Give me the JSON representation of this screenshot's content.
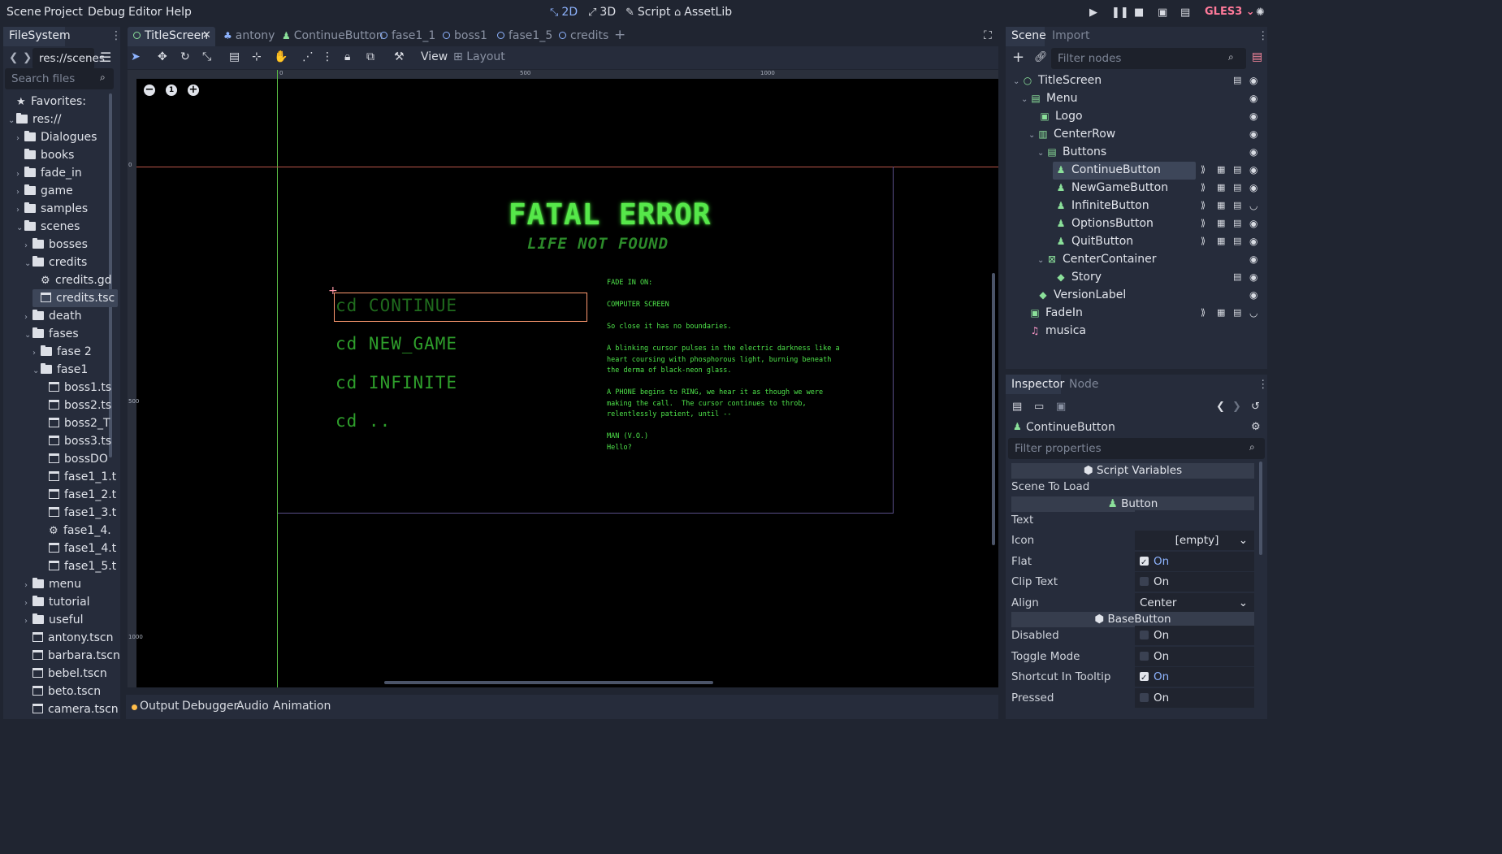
{
  "menu": [
    "Scene",
    "Project",
    "Debug",
    "Editor",
    "Help"
  ],
  "modes": {
    "m2d": "2D",
    "m3d": "3D",
    "script": "Script",
    "assetlib": "AssetLib"
  },
  "renderer": "GLES3",
  "filesystem": {
    "tab": "FileSystem",
    "path": "res://scenes",
    "search_placeholder": "Search files",
    "rows": [
      {
        "label": "Favorites:",
        "kind": "star"
      },
      {
        "label": "res://",
        "kind": "folder"
      },
      {
        "label": "Dialogues",
        "kind": "folder"
      },
      {
        "label": "books",
        "kind": "folder"
      },
      {
        "label": "fade_in",
        "kind": "folder"
      },
      {
        "label": "game",
        "kind": "folder"
      },
      {
        "label": "samples",
        "kind": "folder"
      },
      {
        "label": "scenes",
        "kind": "folder"
      },
      {
        "label": "bosses",
        "kind": "folder"
      },
      {
        "label": "credits",
        "kind": "folder"
      },
      {
        "label": "credits.gd",
        "kind": "gear"
      },
      {
        "label": "credits.tsc",
        "kind": "file"
      },
      {
        "label": "death",
        "kind": "folder"
      },
      {
        "label": "fases",
        "kind": "folder"
      },
      {
        "label": "fase 2",
        "kind": "folder"
      },
      {
        "label": "fase1",
        "kind": "folder"
      },
      {
        "label": "boss1.ts",
        "kind": "file"
      },
      {
        "label": "boss2.ts",
        "kind": "file"
      },
      {
        "label": "boss2_T",
        "kind": "file"
      },
      {
        "label": "boss3.ts",
        "kind": "file"
      },
      {
        "label": "bossDO",
        "kind": "file"
      },
      {
        "label": "fase1_1.t",
        "kind": "file"
      },
      {
        "label": "fase1_2.t",
        "kind": "file"
      },
      {
        "label": "fase1_3.t",
        "kind": "file"
      },
      {
        "label": "fase1_4.",
        "kind": "gear"
      },
      {
        "label": "fase1_4.t",
        "kind": "file"
      },
      {
        "label": "fase1_5.t",
        "kind": "file"
      },
      {
        "label": "menu",
        "kind": "folder"
      },
      {
        "label": "tutorial",
        "kind": "folder"
      },
      {
        "label": "useful",
        "kind": "folder"
      },
      {
        "label": "antony.tscn",
        "kind": "file"
      },
      {
        "label": "barbara.tscn",
        "kind": "file"
      },
      {
        "label": "bebel.tscn",
        "kind": "file"
      },
      {
        "label": "beto.tscn",
        "kind": "file"
      },
      {
        "label": "camera.tscn",
        "kind": "file"
      }
    ]
  },
  "editor_tabs": [
    "TitleScreen",
    "antony",
    "ContinueButton",
    "fase1_1",
    "boss1",
    "fase1_5",
    "credits"
  ],
  "toolbar": {
    "view": "View",
    "layout": "Layout"
  },
  "rulers": {
    "r0": "0",
    "r500": "500",
    "r1000": "1000"
  },
  "game": {
    "title": "FATAL ERROR",
    "subtitle": "LIFE NOT FOUND",
    "buttons": [
      "cd CONTINUE",
      "cd NEW_GAME",
      "cd INFINITE",
      "cd .."
    ],
    "story": "FADE IN ON:\n\nCOMPUTER SCREEN\n\nSo close it has no boundaries.\n\nA blinking cursor pulses in the electric darkness like a\nheart coursing with phosphorous light, burning beneath\nthe derma of black-neon glass.\n\nA PHONE begins to RING, we hear it as though we were\nmaking the call.  The cursor continues to throb,\nrelentlessly patient, until --\n\nMAN (V.O.)\nHello?"
  },
  "bottom_tabs": [
    "Output",
    "Debugger",
    "Audio",
    "Animation"
  ],
  "scene_dock": {
    "tabs": [
      "Scene",
      "Import"
    ],
    "filter_placeholder": "Filter nodes",
    "nodes": [
      "TitleScreen",
      "Menu",
      "Logo",
      "CenterRow",
      "Buttons",
      "ContinueButton",
      "NewGameButton",
      "InfiniteButton",
      "OptionsButton",
      "QuitButton",
      "CenterContainer",
      "Story",
      "VersionLabel",
      "FadeIn",
      "musica"
    ]
  },
  "inspector": {
    "tabs": [
      "Inspector",
      "Node"
    ],
    "object": "ContinueButton",
    "filter_placeholder": "Filter properties",
    "sections": {
      "script": "Script Variables",
      "button": "Button",
      "basebutton": "BaseButton"
    },
    "props": {
      "scene_to_load": "Scene To Load",
      "text": "Text",
      "icon": "Icon",
      "icon_val": "[empty]",
      "flat": "Flat",
      "flat_val": "On",
      "clip": "Clip Text",
      "clip_val": "On",
      "align": "Align",
      "align_val": "Center",
      "disabled": "Disabled",
      "disabled_val": "On",
      "toggle": "Toggle Mode",
      "toggle_val": "On",
      "shortcut": "Shortcut In Tooltip",
      "shortcut_val": "On",
      "pressed": "Pressed",
      "pressed_val": "On"
    }
  },
  "colors": {
    "accent": "#8eb4ff",
    "node_green": "#8be09a",
    "game_green": "#4ee34a",
    "bg": "#202531"
  }
}
